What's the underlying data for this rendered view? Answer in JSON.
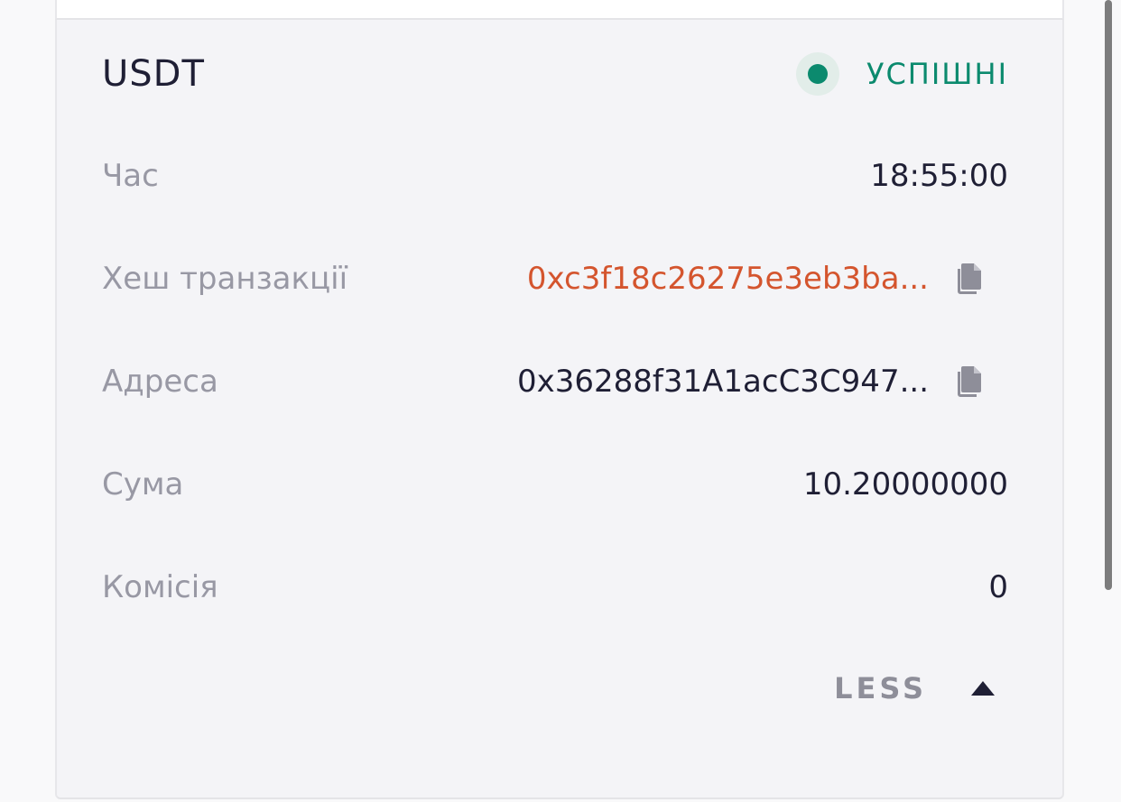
{
  "transaction": {
    "asset": "USDT",
    "status": "УСПІШНІ",
    "rows": [
      {
        "label": "Час",
        "value": "18:55:00"
      },
      {
        "label": "Хеш транзакції",
        "value": "0xc3f18c26275e3eb3ba..."
      },
      {
        "label": "Адреса",
        "value": "0x36288f31A1acC3C947..."
      },
      {
        "label": "Сума",
        "value": "10.20000000"
      },
      {
        "label": "Комісія",
        "value": "0"
      }
    ],
    "toggle_label": "LESS"
  },
  "colors": {
    "success": "#0b8a6e",
    "hash_link": "#d4552e",
    "text_primary": "#1f1f35",
    "text_muted": "#9898a4",
    "card_bg": "#f4f4f7"
  },
  "icons": {
    "status": "status-dot-icon",
    "copy": "copy-icon",
    "toggle": "caret-up-icon"
  }
}
